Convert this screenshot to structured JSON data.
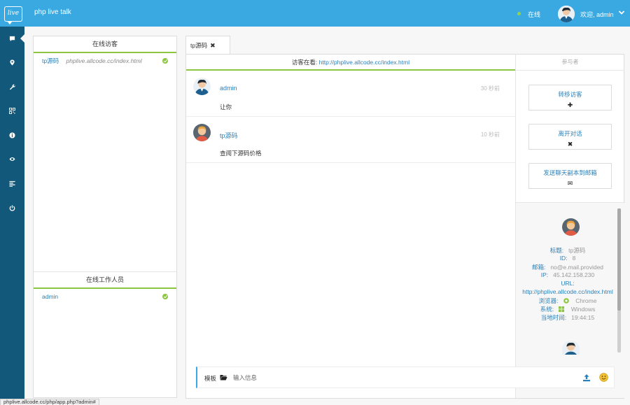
{
  "header": {
    "logo_text": "live",
    "title": "php live talk",
    "status": "在线",
    "welcome": "欢迎, admin",
    "status_color": "#8fd44a",
    "bar_color": "#3aa9e1"
  },
  "sidenav": {
    "icons": [
      "chat-icon",
      "map-marker-icon",
      "wrench-icon",
      "qrcode-icon",
      "info-icon",
      "eye-icon",
      "list-icon",
      "power-icon"
    ]
  },
  "visitors": {
    "title": "在线访客",
    "items": [
      {
        "name": "tp源码",
        "url": "phplive.allcode.cc/index.html"
      }
    ]
  },
  "staff": {
    "title": "在线工作人员",
    "items": [
      {
        "name": "admin"
      }
    ]
  },
  "chat": {
    "tab_label": "tp源码",
    "tab_close": "✖",
    "viewing_label": "访客在看:",
    "viewing_url": "http://phplive.allcode.cc/index.html",
    "participants_label": "参与者",
    "messages": [
      {
        "sender": "admin",
        "time": "30 秒前",
        "text": "让你"
      },
      {
        "sender": "tp源码",
        "time": "10 秒前",
        "text": "查阅下源码价格"
      }
    ]
  },
  "actions": [
    {
      "label": "转移访客",
      "icon": "✚"
    },
    {
      "label": "离开对话",
      "icon": "✖"
    },
    {
      "label": "发送聊天副本到邮箱",
      "icon": "✉"
    }
  ],
  "visitor_info": {
    "title_label": "标题:",
    "title_value": "tp源码",
    "id_label": "ID:",
    "id_value": "8",
    "email_label": "邮箱:",
    "email_value": "no@e.mail.provided",
    "ip_label": "IP:",
    "ip_value": "45.142.158.230",
    "url_label": "URL:",
    "url_value": "http://phplive.allcode.cc/index.html",
    "browser_label": "浏览器:",
    "browser_value": "Chrome",
    "os_label": "系统:",
    "os_value": "Windows",
    "localtime_label": "当地时间:",
    "localtime_value": "19:44:15"
  },
  "composer": {
    "template_label": "模板",
    "placeholder": "输入信息"
  },
  "statusbar": {
    "url": "phplive.allcode.cc/php/app.php?admin#"
  }
}
